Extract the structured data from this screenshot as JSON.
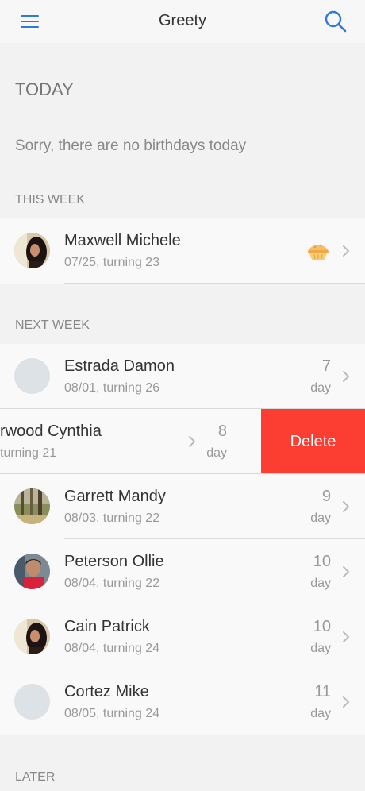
{
  "nav": {
    "title": "Greety",
    "menu_icon": "hamburger-menu-icon",
    "search_icon": "search-icon",
    "accent_color": "#2f7ad9"
  },
  "today": {
    "title": "TODAY",
    "empty_message": "Sorry, there are no birthdays today"
  },
  "this_week": {
    "title": "THIS WEEK",
    "items": [
      {
        "name": "Maxwell Michele",
        "sub": "07/25, turning 23",
        "badge_icon": "pie-icon"
      }
    ]
  },
  "next_week": {
    "title": "NEXT WEEK",
    "items": [
      {
        "name": "Estrada Damon",
        "sub": "08/01, turning 26",
        "days": "7",
        "unit": "day"
      },
      {
        "name": "rwood Cynthia",
        "sub": "turning 21",
        "days": "8",
        "unit": "day",
        "swiped": true
      },
      {
        "name": "Garrett Mandy",
        "sub": "08/03, turning 22",
        "days": "9",
        "unit": "day"
      },
      {
        "name": "Peterson Ollie",
        "sub": "08/04, turning 22",
        "days": "10",
        "unit": "day"
      },
      {
        "name": "Cain Patrick",
        "sub": "08/04, turning 24",
        "days": "10",
        "unit": "day"
      },
      {
        "name": "Cortez Mike",
        "sub": "08/05, turning 24",
        "days": "11",
        "unit": "day"
      }
    ],
    "delete_label": "Delete",
    "delete_color": "#fc3d31"
  },
  "later": {
    "title": "LATER"
  }
}
